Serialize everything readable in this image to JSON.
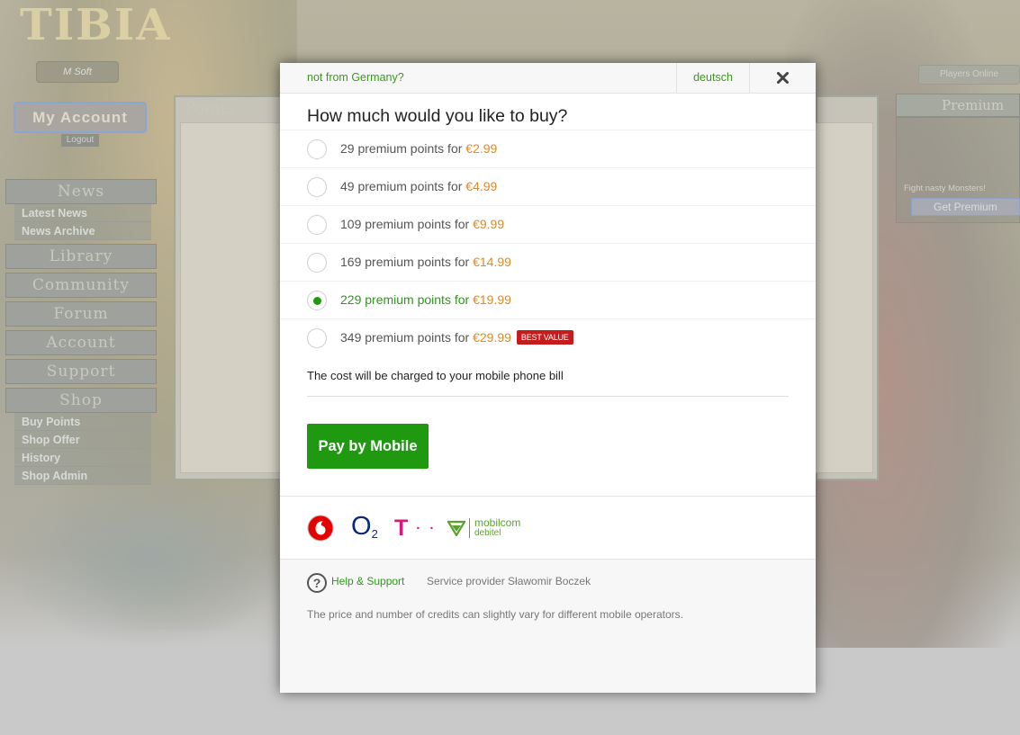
{
  "background": {
    "logo": "TIBIA",
    "logo_sub": "M Soft",
    "my_account": "My Account",
    "logout": "Logout",
    "menu": [
      {
        "head": "News",
        "subs": [
          "Latest News",
          "News Archive"
        ]
      },
      {
        "head": "Library",
        "subs": []
      },
      {
        "head": "Community",
        "subs": []
      },
      {
        "head": "Forum",
        "subs": []
      },
      {
        "head": "Account",
        "subs": []
      },
      {
        "head": "Support",
        "subs": []
      },
      {
        "head": "Shop",
        "subs": [
          "Buy Points",
          "Shop Offer",
          "History",
          "Shop Admin"
        ]
      }
    ],
    "points_title": "Points",
    "players_online": "Players Online",
    "premium_title": "Premium",
    "premium_text": "Fight nasty Monsters!",
    "premium_button": "Get Premium"
  },
  "modal": {
    "not_from_germany": "not from Germany?",
    "language": "deutsch",
    "question": "How much would you like to buy?",
    "options": [
      {
        "label": "29 premium points for ",
        "price": "€2.99",
        "selected": false,
        "badge": ""
      },
      {
        "label": "49 premium points for ",
        "price": "€4.99",
        "selected": false,
        "badge": ""
      },
      {
        "label": "109 premium points for ",
        "price": "€9.99",
        "selected": false,
        "badge": ""
      },
      {
        "label": "169 premium points for ",
        "price": "€14.99",
        "selected": false,
        "badge": ""
      },
      {
        "label": "229 premium points for ",
        "price": "€19.99",
        "selected": true,
        "badge": ""
      },
      {
        "label": "349 premium points for ",
        "price": "€29.99",
        "selected": false,
        "badge": "BEST VALUE"
      }
    ],
    "charge_note": "The cost will be charged to your mobile phone bill",
    "pay_button": "Pay by Mobile",
    "operators": {
      "o2": "O",
      "o2_sub": "2",
      "telekom": "T",
      "telekom_dots": "· ·",
      "mobilcom_line1": "mobilcom",
      "mobilcom_line2": "debitel"
    },
    "help_link": "Help & Support",
    "help_icon_glyph": "?",
    "provider": "Service provider Sławomir Boczek",
    "disclaimer": "The price and number of credits can slightly vary for different mobile operators."
  },
  "colors": {
    "accent_green": "#1f9a10",
    "link_green": "#3a9a1b",
    "price_orange": "#e08a1e",
    "badge_red": "#c51d1d"
  }
}
